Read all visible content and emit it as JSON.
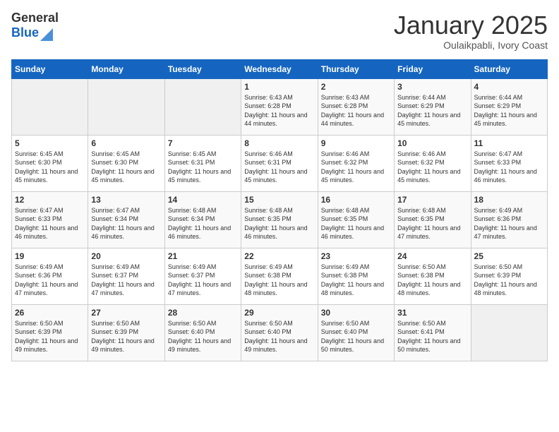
{
  "header": {
    "logo_line1": "General",
    "logo_line2": "Blue",
    "month": "January 2025",
    "location": "Oulaikpabli, Ivory Coast"
  },
  "days_of_week": [
    "Sunday",
    "Monday",
    "Tuesday",
    "Wednesday",
    "Thursday",
    "Friday",
    "Saturday"
  ],
  "weeks": [
    [
      {
        "day": "",
        "empty": true
      },
      {
        "day": "",
        "empty": true
      },
      {
        "day": "",
        "empty": true
      },
      {
        "day": "1",
        "sunrise": "6:43 AM",
        "sunset": "6:28 PM",
        "daylight": "11 hours and 44 minutes."
      },
      {
        "day": "2",
        "sunrise": "6:43 AM",
        "sunset": "6:28 PM",
        "daylight": "11 hours and 44 minutes."
      },
      {
        "day": "3",
        "sunrise": "6:44 AM",
        "sunset": "6:29 PM",
        "daylight": "11 hours and 45 minutes."
      },
      {
        "day": "4",
        "sunrise": "6:44 AM",
        "sunset": "6:29 PM",
        "daylight": "11 hours and 45 minutes."
      }
    ],
    [
      {
        "day": "5",
        "sunrise": "6:45 AM",
        "sunset": "6:30 PM",
        "daylight": "11 hours and 45 minutes."
      },
      {
        "day": "6",
        "sunrise": "6:45 AM",
        "sunset": "6:30 PM",
        "daylight": "11 hours and 45 minutes."
      },
      {
        "day": "7",
        "sunrise": "6:45 AM",
        "sunset": "6:31 PM",
        "daylight": "11 hours and 45 minutes."
      },
      {
        "day": "8",
        "sunrise": "6:46 AM",
        "sunset": "6:31 PM",
        "daylight": "11 hours and 45 minutes."
      },
      {
        "day": "9",
        "sunrise": "6:46 AM",
        "sunset": "6:32 PM",
        "daylight": "11 hours and 45 minutes."
      },
      {
        "day": "10",
        "sunrise": "6:46 AM",
        "sunset": "6:32 PM",
        "daylight": "11 hours and 45 minutes."
      },
      {
        "day": "11",
        "sunrise": "6:47 AM",
        "sunset": "6:33 PM",
        "daylight": "11 hours and 46 minutes."
      }
    ],
    [
      {
        "day": "12",
        "sunrise": "6:47 AM",
        "sunset": "6:33 PM",
        "daylight": "11 hours and 46 minutes."
      },
      {
        "day": "13",
        "sunrise": "6:47 AM",
        "sunset": "6:34 PM",
        "daylight": "11 hours and 46 minutes."
      },
      {
        "day": "14",
        "sunrise": "6:48 AM",
        "sunset": "6:34 PM",
        "daylight": "11 hours and 46 minutes."
      },
      {
        "day": "15",
        "sunrise": "6:48 AM",
        "sunset": "6:35 PM",
        "daylight": "11 hours and 46 minutes."
      },
      {
        "day": "16",
        "sunrise": "6:48 AM",
        "sunset": "6:35 PM",
        "daylight": "11 hours and 46 minutes."
      },
      {
        "day": "17",
        "sunrise": "6:48 AM",
        "sunset": "6:35 PM",
        "daylight": "11 hours and 47 minutes."
      },
      {
        "day": "18",
        "sunrise": "6:49 AM",
        "sunset": "6:36 PM",
        "daylight": "11 hours and 47 minutes."
      }
    ],
    [
      {
        "day": "19",
        "sunrise": "6:49 AM",
        "sunset": "6:36 PM",
        "daylight": "11 hours and 47 minutes."
      },
      {
        "day": "20",
        "sunrise": "6:49 AM",
        "sunset": "6:37 PM",
        "daylight": "11 hours and 47 minutes."
      },
      {
        "day": "21",
        "sunrise": "6:49 AM",
        "sunset": "6:37 PM",
        "daylight": "11 hours and 47 minutes."
      },
      {
        "day": "22",
        "sunrise": "6:49 AM",
        "sunset": "6:38 PM",
        "daylight": "11 hours and 48 minutes."
      },
      {
        "day": "23",
        "sunrise": "6:49 AM",
        "sunset": "6:38 PM",
        "daylight": "11 hours and 48 minutes."
      },
      {
        "day": "24",
        "sunrise": "6:50 AM",
        "sunset": "6:38 PM",
        "daylight": "11 hours and 48 minutes."
      },
      {
        "day": "25",
        "sunrise": "6:50 AM",
        "sunset": "6:39 PM",
        "daylight": "11 hours and 48 minutes."
      }
    ],
    [
      {
        "day": "26",
        "sunrise": "6:50 AM",
        "sunset": "6:39 PM",
        "daylight": "11 hours and 49 minutes."
      },
      {
        "day": "27",
        "sunrise": "6:50 AM",
        "sunset": "6:39 PM",
        "daylight": "11 hours and 49 minutes."
      },
      {
        "day": "28",
        "sunrise": "6:50 AM",
        "sunset": "6:40 PM",
        "daylight": "11 hours and 49 minutes."
      },
      {
        "day": "29",
        "sunrise": "6:50 AM",
        "sunset": "6:40 PM",
        "daylight": "11 hours and 49 minutes."
      },
      {
        "day": "30",
        "sunrise": "6:50 AM",
        "sunset": "6:40 PM",
        "daylight": "11 hours and 50 minutes."
      },
      {
        "day": "31",
        "sunrise": "6:50 AM",
        "sunset": "6:41 PM",
        "daylight": "11 hours and 50 minutes."
      },
      {
        "day": "",
        "empty": true
      }
    ]
  ],
  "labels": {
    "sunrise": "Sunrise:",
    "sunset": "Sunset:",
    "daylight": "Daylight hours"
  }
}
